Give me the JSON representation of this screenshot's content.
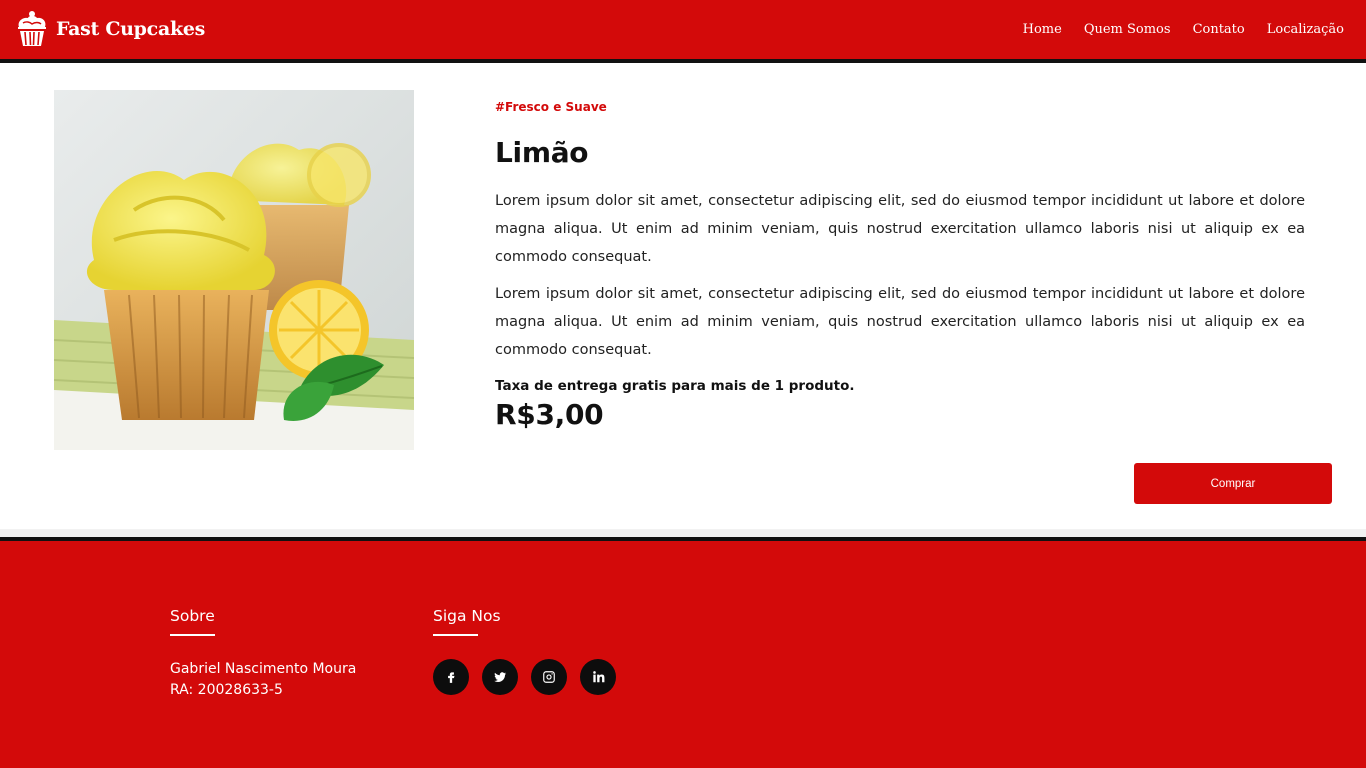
{
  "header": {
    "brand": "Fast Cupcakes",
    "nav": [
      "Home",
      "Quem Somos",
      "Contato",
      "Localização"
    ]
  },
  "product": {
    "tag": "#Fresco e Suave",
    "title": "Limão",
    "description": [
      "Lorem ipsum dolor sit amet, consectetur adipiscing elit, sed do eiusmod tempor incididunt ut labore et dolore magna aliqua. Ut enim ad minim veniam, quis nostrud exercitation ullamco laboris nisi ut aliquip ex ea commodo consequat.",
      "Lorem ipsum dolor sit amet, consectetur adipiscing elit, sed do eiusmod tempor incididunt ut labore et dolore magna aliqua. Ut enim ad minim veniam, quis nostrud exercitation ullamco laboris nisi ut aliquip ex ea commodo consequat."
    ],
    "delivery": "Taxa de entrega gratis para mais de 1 produto.",
    "price": "R$3,00",
    "buy_label": "Comprar"
  },
  "footer": {
    "about_heading": "Sobre",
    "about_name": "Gabriel Nascimento Moura",
    "about_ra": "RA: 20028633-5",
    "social_heading": "Siga Nos",
    "social_icons": [
      "facebook-icon",
      "twitter-icon",
      "instagram-icon",
      "linkedin-icon"
    ]
  },
  "colors": {
    "brand_red": "#d30a0a",
    "dark": "#111111"
  }
}
